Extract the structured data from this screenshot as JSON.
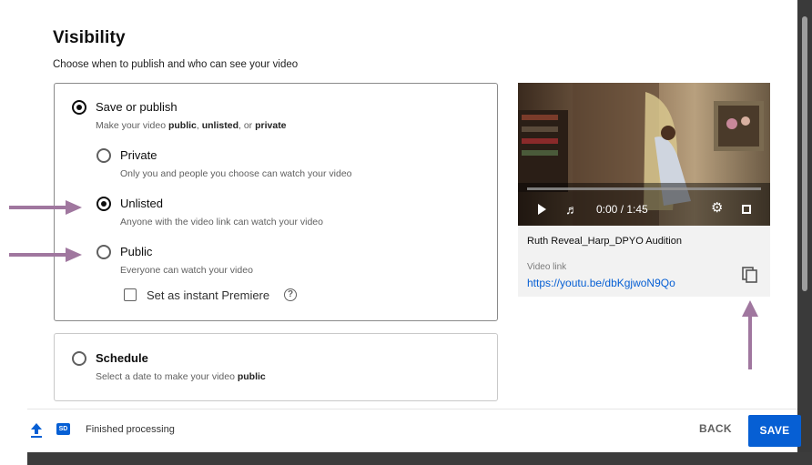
{
  "dialog": {
    "title": "Visibility",
    "subtitle": "Choose when to publish and who can see your video"
  },
  "save_or_publish": {
    "label": "Save or publish",
    "desc_prefix": "Make your video ",
    "desc_public": "public",
    "desc_sep1": ", ",
    "desc_unlisted": "unlisted",
    "desc_sep2": ", or ",
    "desc_private": "private",
    "selected": true
  },
  "options": {
    "private": {
      "label": "Private",
      "desc": "Only you and people you choose can watch your video",
      "selected": false
    },
    "unlisted": {
      "label": "Unlisted",
      "desc": "Anyone with the video link can watch your video",
      "selected": true
    },
    "public": {
      "label": "Public",
      "desc": "Everyone can watch your video",
      "selected": false
    }
  },
  "premiere": {
    "label": "Set as instant Premiere",
    "checked": false,
    "help_icon": "help-circle-icon"
  },
  "schedule": {
    "label": "Schedule",
    "desc_prefix": "Select a date to make your video ",
    "desc_bold": "public",
    "selected": false
  },
  "video": {
    "time": "0:00 / 1:45",
    "progress": 0,
    "title": "Ruth Reveal_Harp_DPYO Audition",
    "link_label": "Video link",
    "link": "https://youtu.be/dbKgjwoN9Qo"
  },
  "footer": {
    "status": "Finished processing",
    "sd_badge": "SD",
    "back": "BACK",
    "save": "SAVE"
  },
  "colors": {
    "accent": "#065fd4",
    "annotation_arrow": "#a0779f"
  }
}
